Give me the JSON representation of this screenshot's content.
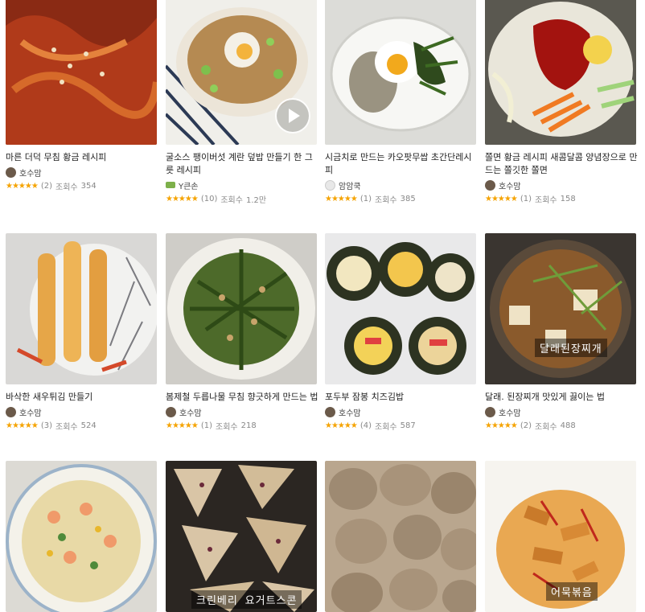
{
  "cards": [
    {
      "title": "마른 더덕 무침 황금 레시피",
      "author": "호수맘",
      "stars": "★★★★★",
      "reviews": "(2)",
      "views_label": "조회수",
      "views": "354"
    },
    {
      "title": "굴소스 팽이버섯 계란 덮밥 만들기 한 그릇 레시피",
      "author": "Y큰손",
      "stars": "★★★★★",
      "reviews": "(10)",
      "views_label": "조회수",
      "views": "1.2만"
    },
    {
      "title": "시금치로 만드는 카오팟무쌉 초간단레시피",
      "author": "암암쿡",
      "stars": "★★★★★",
      "reviews": "(1)",
      "views_label": "조회수",
      "views": "385"
    },
    {
      "title": "쫄면 황금 레시피 새콤달콤 양념장으로 만드는 쫄깃한 쫄면",
      "author": "호수맘",
      "stars": "★★★★★",
      "reviews": "(1)",
      "views_label": "조회수",
      "views": "158"
    },
    {
      "title": "바삭한 새우튀김 만들기",
      "author": "호수맘",
      "stars": "★★★★★",
      "reviews": "(3)",
      "views_label": "조회수",
      "views": "524"
    },
    {
      "title": "봄제철 두릅나물 무침 향긋하게 만드는 법",
      "author": "호수맘",
      "stars": "★★★★★",
      "reviews": "(1)",
      "views_label": "조회수",
      "views": "218"
    },
    {
      "title": "포두부 잠봉 치즈김밥",
      "author": "호수맘",
      "stars": "★★★★★",
      "reviews": "(4)",
      "views_label": "조회수",
      "views": "587"
    },
    {
      "title": "달래. 된장찌개 맛있게 끓이는 법",
      "author": "호수맘",
      "stars": "★★★★★",
      "reviews": "(2)",
      "views_label": "조회수",
      "views": "488",
      "overlay": "달래된장찌개"
    },
    {
      "overlay": ""
    },
    {
      "overlay": "크린베리 요거트스콘"
    },
    {
      "overlay": ""
    },
    {
      "overlay": "어묵볶음"
    }
  ],
  "colors": {
    "star": "#f5a300",
    "text": "#222222",
    "muted": "#888888"
  }
}
